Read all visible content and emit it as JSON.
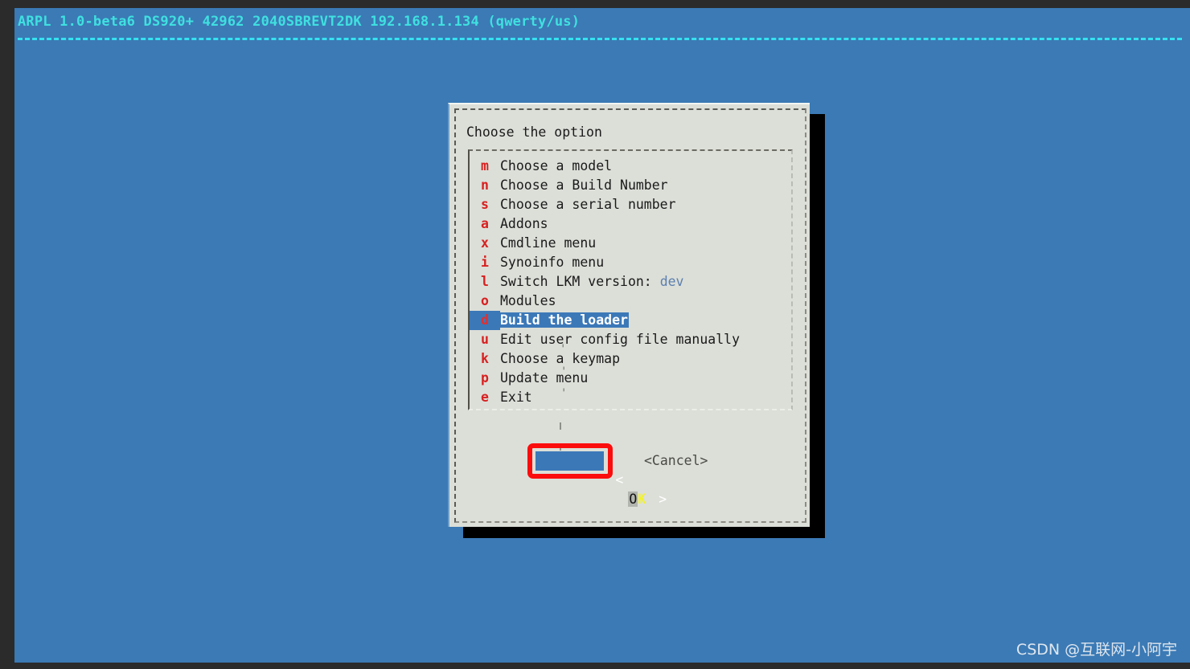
{
  "terminal": {
    "status_line": "ARPL 1.0-beta6 DS920+ 42962 2040SBREVT2DK 192.168.1.134 (qwerty/us)",
    "background_color": "#3b7ab5",
    "status_color": "#3fe0e0"
  },
  "dialog": {
    "title": "Choose the option",
    "background_color": "#dcdfd8",
    "menu_items": [
      {
        "hotkey": "m",
        "label": "Choose a model",
        "value": "",
        "selected": false
      },
      {
        "hotkey": "n",
        "label": "Choose a Build Number",
        "value": "",
        "selected": false
      },
      {
        "hotkey": "s",
        "label": "Choose a serial number",
        "value": "",
        "selected": false
      },
      {
        "hotkey": "a",
        "label": "Addons",
        "value": "",
        "selected": false
      },
      {
        "hotkey": "x",
        "label": "Cmdline menu",
        "value": "",
        "selected": false
      },
      {
        "hotkey": "i",
        "label": "Synoinfo menu",
        "value": "",
        "selected": false
      },
      {
        "hotkey": "l",
        "label": "Switch LKM version: ",
        "value": "dev",
        "selected": false
      },
      {
        "hotkey": "o",
        "label": "Modules",
        "value": "",
        "selected": false
      },
      {
        "hotkey": "d",
        "label": "Build the loader",
        "value": "",
        "selected": true
      },
      {
        "hotkey": "u",
        "label": "Edit user config file manually",
        "value": "",
        "selected": false
      },
      {
        "hotkey": "k",
        "label": "Choose a keymap",
        "value": "",
        "selected": false
      },
      {
        "hotkey": "p",
        "label": "Update menu",
        "value": "",
        "selected": false
      },
      {
        "hotkey": "e",
        "label": "Exit",
        "value": "",
        "selected": false
      }
    ],
    "buttons": {
      "ok_left_bracket": "<",
      "ok_letter_o": "O",
      "ok_letter_k": "K",
      "ok_right_bracket": ">",
      "cancel_label": "<Cancel>",
      "highlight_color": "#fb0d0d",
      "focus_color": "#3b78b8"
    }
  },
  "watermark": {
    "text": "CSDN @互联网-小阿宇"
  }
}
